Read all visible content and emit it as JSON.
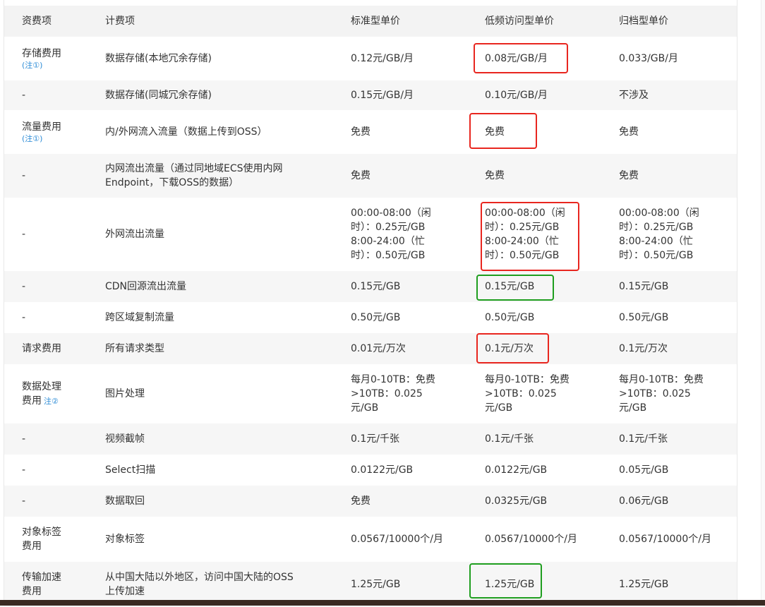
{
  "header": {
    "col_category": "资费项",
    "col_item": "计费项",
    "col_standard": "标准型单价",
    "col_ia": "低频访问型单价",
    "col_archive": "归档型单价"
  },
  "rows": [
    {
      "category": [
        "存储费用"
      ],
      "note": "(注①)",
      "item": [
        "数据存储(本地冗余存储)"
      ],
      "standard": [
        "0.12元/GB/月"
      ],
      "ia": [
        "0.08元/GB/月"
      ],
      "archive": [
        "0.033/GB/月"
      ]
    },
    {
      "category": [
        "-"
      ],
      "item": [
        "数据存储(同城冗余存储)"
      ],
      "standard": [
        "0.15元/GB/月"
      ],
      "ia": [
        "0.10元/GB/月"
      ],
      "archive": [
        "不涉及"
      ]
    },
    {
      "category": [
        "流量费用"
      ],
      "note": "(注①)",
      "item": [
        "内/外网流入流量（数据上传到OSS）"
      ],
      "standard": [
        "免费"
      ],
      "ia": [
        "免费"
      ],
      "archive": [
        "免费"
      ]
    },
    {
      "category": [
        "-"
      ],
      "item": [
        "内网流出流量（通过同地域ECS使用内网",
        "Endpoint，下载OSS的数据）"
      ],
      "standard": [
        "免费"
      ],
      "ia": [
        "免费"
      ],
      "archive": [
        "免费"
      ]
    },
    {
      "category": [
        "-"
      ],
      "item": [
        "外网流出流量"
      ],
      "standard": [
        "00:00-08:00（闲",
        "时）：0.25元/GB",
        "8:00-24:00（忙",
        "时）：0.50元/GB"
      ],
      "ia": [
        "00:00-08:00（闲",
        "时）：0.25元/GB",
        "8:00-24:00（忙",
        "时）：0.50元/GB"
      ],
      "archive": [
        "00:00-08:00（闲",
        "时）：0.25元/GB",
        "8:00-24:00（忙",
        "时）：0.50元/GB"
      ]
    },
    {
      "category": [
        "-"
      ],
      "item": [
        "CDN回源流出流量"
      ],
      "standard": [
        "0.15元/GB"
      ],
      "ia": [
        "0.15元/GB"
      ],
      "archive": [
        "0.15元/GB"
      ]
    },
    {
      "category": [
        "-"
      ],
      "item": [
        "跨区域复制流量"
      ],
      "standard": [
        "0.50元/GB"
      ],
      "ia": [
        "0.50元/GB"
      ],
      "archive": [
        "0.50元/GB"
      ]
    },
    {
      "category": [
        "请求费用"
      ],
      "item": [
        "所有请求类型"
      ],
      "standard": [
        "0.01元/万次"
      ],
      "ia": [
        "0.1元/万次"
      ],
      "archive": [
        "0.1元/万次"
      ]
    },
    {
      "category": [
        "数据处理",
        "费用"
      ],
      "note_inline": "注②",
      "item": [
        "图片处理"
      ],
      "standard": [
        "每月0-10TB：免费",
        ">10TB：0.025",
        "元/GB"
      ],
      "ia": [
        "每月0-10TB：免费",
        ">10TB：0.025",
        "元/GB"
      ],
      "archive": [
        "每月0-10TB：免费",
        ">10TB：0.025",
        "元/GB"
      ]
    },
    {
      "category": [
        "-"
      ],
      "item": [
        "视频截帧"
      ],
      "standard": [
        "0.1元/千张"
      ],
      "ia": [
        "0.1元/千张"
      ],
      "archive": [
        "0.1元/千张"
      ]
    },
    {
      "category": [
        "-"
      ],
      "item": [
        "Select扫描"
      ],
      "standard": [
        "0.0122元/GB"
      ],
      "ia": [
        "0.0122元/GB"
      ],
      "archive": [
        "0.05元/GB"
      ]
    },
    {
      "category": [
        "-"
      ],
      "item": [
        "数据取回"
      ],
      "standard": [
        "免费"
      ],
      "ia": [
        "0.0325元/GB"
      ],
      "archive": [
        "0.06元/GB"
      ]
    },
    {
      "category": [
        "对象标签",
        "费用"
      ],
      "item": [
        "对象标签"
      ],
      "standard": [
        "0.0567/10000个/月"
      ],
      "ia": [
        "0.0567/10000个/月"
      ],
      "archive": [
        "0.0567/10000个/月"
      ]
    },
    {
      "category": [
        "传输加速",
        "费用"
      ],
      "item": [
        "从中国大陆以外地区，访问中国大陆的OSS",
        "上传加速"
      ],
      "standard": [
        "1.25元/GB"
      ],
      "ia": [
        "1.25元/GB"
      ],
      "archive": [
        "1.25元/GB"
      ]
    }
  ],
  "annotation_colors": {
    "red": "#e8261f",
    "green": "#1f9e1f"
  }
}
